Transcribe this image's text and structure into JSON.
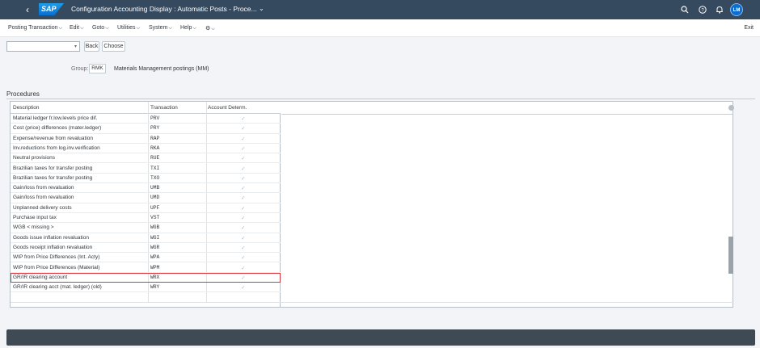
{
  "shell": {
    "title": "Configuration Accounting Display : Automatic Posts - Proce...",
    "user_initials": "LM"
  },
  "menu": {
    "items": [
      "Posting Transaction",
      "Edit",
      "Goto",
      "Utilities",
      "System",
      "Help"
    ],
    "exit_label": "Exit"
  },
  "toolbar": {
    "command_value": "",
    "back_label": "Back",
    "choose_label": "Choose"
  },
  "group": {
    "label": "Group:",
    "value": "RMK",
    "description": "Materials Management postings (MM)"
  },
  "procedures": {
    "title": "Procedures",
    "columns": [
      "Description",
      "Transaction",
      "Account Determ."
    ],
    "rows": [
      {
        "description": "Material ledger fr.low.levels price dif.",
        "transaction": "PRV",
        "checked": true
      },
      {
        "description": "Cost (price) differences (mater.ledger)",
        "transaction": "PRY",
        "checked": true
      },
      {
        "description": "Expense/revenue from revaluation",
        "transaction": "RAP",
        "checked": true
      },
      {
        "description": "Inv.reductions from log.inv.verification",
        "transaction": "RKA",
        "checked": true
      },
      {
        "description": "Neutral provisions",
        "transaction": "RUE",
        "checked": true
      },
      {
        "description": "Brazilian taxes for transfer posting",
        "transaction": "TXI",
        "checked": true
      },
      {
        "description": "Brazilian taxes for transfer posting",
        "transaction": "TXO",
        "checked": true
      },
      {
        "description": "Gain/loss from revaluation",
        "transaction": "UMB",
        "checked": true
      },
      {
        "description": "Gain/loss from revaluation",
        "transaction": "UMD",
        "checked": true
      },
      {
        "description": "Unplanned delivery costs",
        "transaction": "UPF",
        "checked": true
      },
      {
        "description": "Purchase input tax",
        "transaction": "VST",
        "checked": true
      },
      {
        "description": "WGB < missing >",
        "transaction": "WGB",
        "checked": true
      },
      {
        "description": "Goods issue inflation revaluation",
        "transaction": "WGI",
        "checked": true
      },
      {
        "description": "Goods receipt inflation revaluation",
        "transaction": "WGR",
        "checked": true
      },
      {
        "description": "WIP from Price Differences (Int. Acty)",
        "transaction": "WPA",
        "checked": true
      },
      {
        "description": "WIP from Price Differences (Material)",
        "transaction": "WPM",
        "checked": true
      },
      {
        "description": "GR/IR clearing account",
        "transaction": "WRX",
        "checked": true,
        "highlighted": true
      },
      {
        "description": "GR/IR clearing acct (mat. ledger) (old)",
        "transaction": "WRY",
        "checked": true
      }
    ],
    "highlight_color": "#d9363e"
  },
  "icons": {
    "back": "back-arrow-icon",
    "search": "search-icon",
    "help": "help-icon",
    "notifications": "bell-icon",
    "settings": "gear-icon"
  }
}
